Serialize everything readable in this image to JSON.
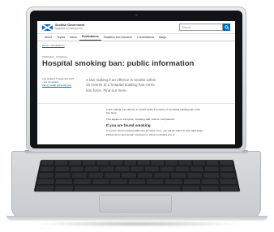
{
  "site": {
    "brand_en": "Scottish Government",
    "brand_gd": "Riaghaltas na h-Alba gov.scot",
    "search_placeholder": "Search",
    "nav": [
      "About",
      "Topics",
      "News",
      "Publications",
      "Statistics and research",
      "Consultations",
      "Blogs"
    ],
    "active_nav_index": 3,
    "breadcrumb": "Home > Publications"
  },
  "page": {
    "label": "Publication - Factsheet",
    "title": "Hospital smoking ban: public information",
    "meta": {
      "updated": "Last updated: 5 September 2022 - See all updates",
      "part_of": "Part of: Health and social care"
    },
    "lede": "A law making it an offence to smoke within 15 metres of a hospital building has come into force. Find out more.",
    "body": {
      "p1": "A law making it an offence to smoke within 15 metres of a hospital building has come into force.",
      "p2": "This applies to everyone, including staff, visitors, and patients.",
      "heading": "If you are found smoking",
      "p3": "If you are found smoking within the 15 metre zone, you will be asked to stop right away. Please do so and remain courteous to those reminding you of"
    }
  },
  "colors": {
    "brand_blue": "#0065bd"
  }
}
